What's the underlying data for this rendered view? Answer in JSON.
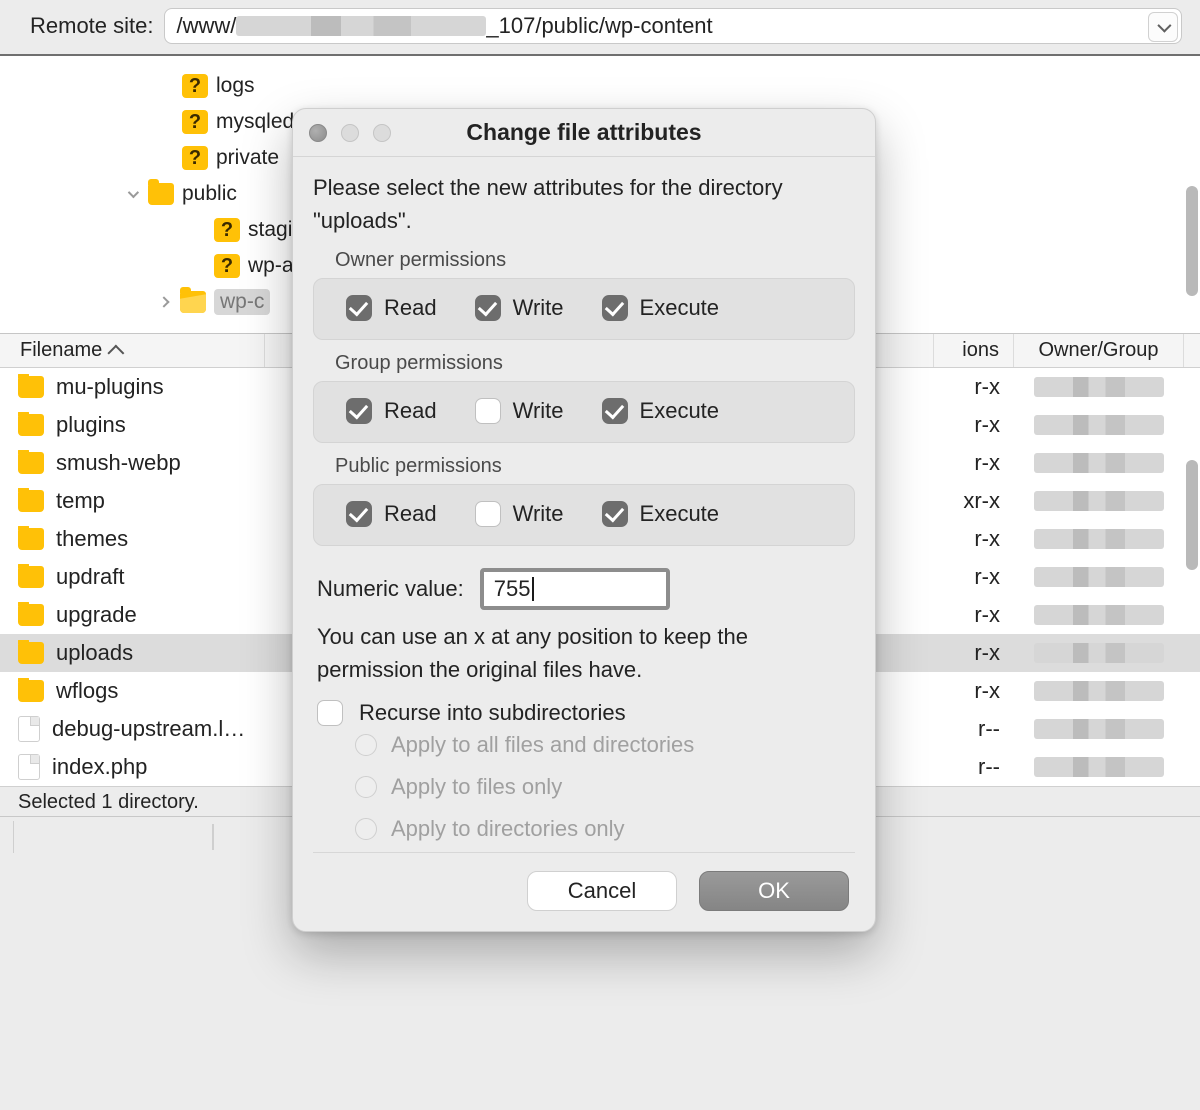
{
  "remote": {
    "label": "Remote site:",
    "path_prefix": "/www/",
    "path_suffix": "_107/public/wp-content"
  },
  "tree": {
    "items": [
      {
        "name": "logs",
        "icon": "question",
        "indent": 0
      },
      {
        "name": "mysqled",
        "icon": "question",
        "indent": 0
      },
      {
        "name": "private",
        "icon": "question",
        "indent": 0
      },
      {
        "name": "public",
        "icon": "folder",
        "indent": 0,
        "expanded": true
      },
      {
        "name": "stagi",
        "icon": "question",
        "indent": 2
      },
      {
        "name": "wp-a",
        "icon": "question",
        "indent": 2
      },
      {
        "name": "wp-c",
        "icon": "folder-open",
        "indent": 2,
        "has_children": true,
        "selected": true
      }
    ]
  },
  "list": {
    "headers": {
      "filename": "Filename",
      "perm_suffix": "ions",
      "owner": "Owner/Group"
    },
    "rows": [
      {
        "name": "mu-plugins",
        "icon": "folder",
        "perm": "r-x",
        "selected": false
      },
      {
        "name": "plugins",
        "icon": "folder",
        "perm": "r-x",
        "selected": false
      },
      {
        "name": "smush-webp",
        "icon": "folder",
        "perm": "r-x",
        "selected": false
      },
      {
        "name": "temp",
        "icon": "folder",
        "perm": "xr-x",
        "selected": false
      },
      {
        "name": "themes",
        "icon": "folder",
        "perm": "r-x",
        "selected": false
      },
      {
        "name": "updraft",
        "icon": "folder",
        "perm": "r-x",
        "selected": false
      },
      {
        "name": "upgrade",
        "icon": "folder",
        "perm": "r-x",
        "selected": false
      },
      {
        "name": "uploads",
        "icon": "folder",
        "perm": "r-x",
        "selected": true
      },
      {
        "name": "wflogs",
        "icon": "folder",
        "perm": "r-x",
        "selected": false
      },
      {
        "name": "debug-upstream.l…",
        "icon": "file",
        "perm": "r--",
        "selected": false
      },
      {
        "name": "index.php",
        "icon": "file",
        "perm": "r--",
        "selected": false
      }
    ],
    "status": "Selected 1 directory."
  },
  "dialog": {
    "title": "Change file attributes",
    "intro": "Please select the new attributes for the directory \"uploads\".",
    "groups": [
      {
        "label": "Owner permissions",
        "read": true,
        "write": true,
        "execute": true
      },
      {
        "label": "Group permissions",
        "read": true,
        "write": false,
        "execute": true
      },
      {
        "label": "Public permissions",
        "read": true,
        "write": false,
        "execute": true
      }
    ],
    "perm_labels": {
      "read": "Read",
      "write": "Write",
      "execute": "Execute"
    },
    "numeric_label": "Numeric value:",
    "numeric_value": "755",
    "hint": "You can use an x at any position to keep the permission the original files have.",
    "recurse_label": "Recurse into subdirectories",
    "recurse_checked": false,
    "radios": [
      "Apply to all files and directories",
      "Apply to files only",
      "Apply to directories only"
    ],
    "buttons": {
      "cancel": "Cancel",
      "ok": "OK"
    }
  }
}
